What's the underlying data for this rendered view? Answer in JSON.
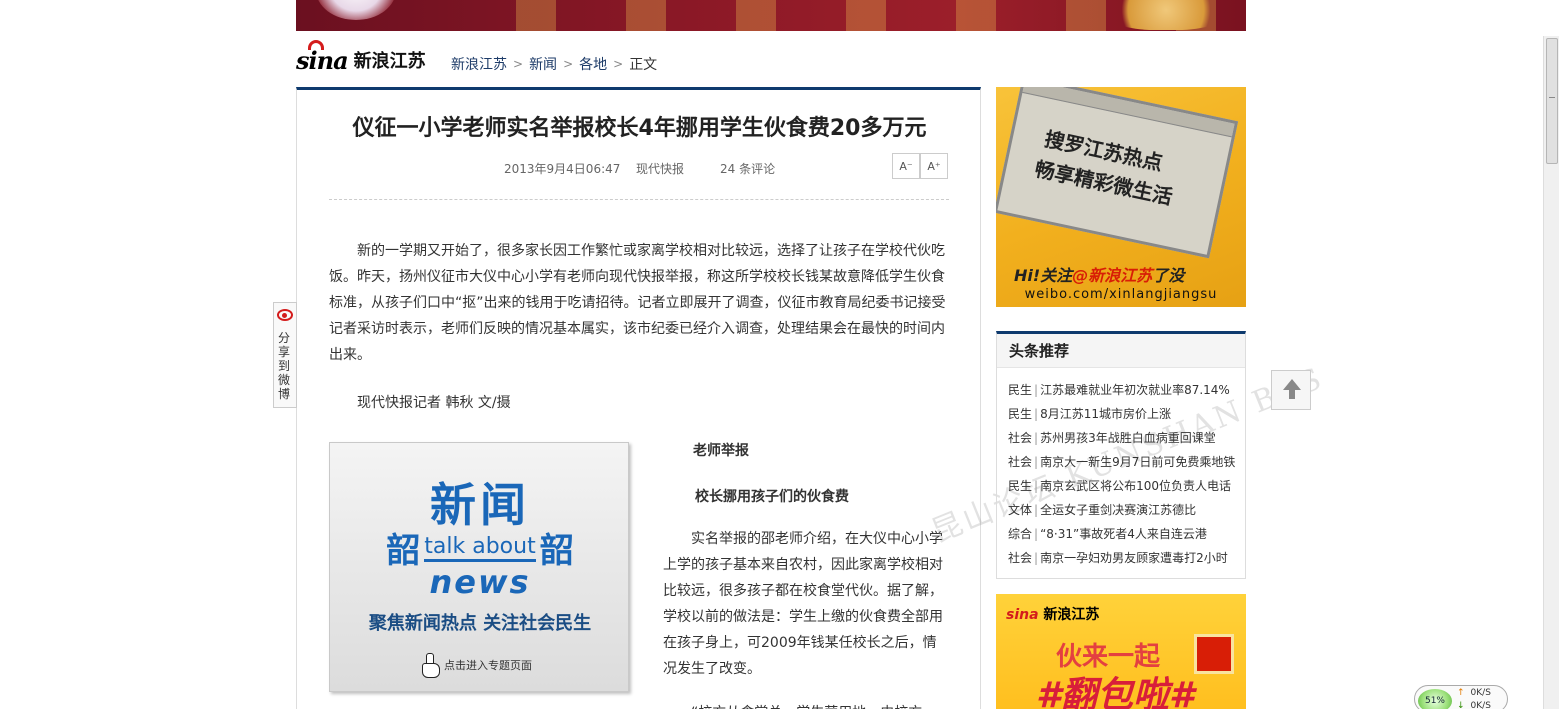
{
  "header": {
    "logo_brand": "sina",
    "logo_text": "新浪江苏",
    "breadcrumb": [
      {
        "label": "新浪江苏"
      },
      {
        "label": "新闻"
      },
      {
        "label": "各地"
      },
      {
        "label": "正文"
      }
    ],
    "breadcrumb_sep": ">"
  },
  "article": {
    "title": "仪征一小学老师实名举报校长4年挪用学生伙食费20多万元",
    "date": "2013年9月4日06:47",
    "source": "现代快报",
    "comments": "24 条评论",
    "font_decrease": "A⁻",
    "font_increase": "A⁺",
    "para1": "新的一学期又开始了，很多家长因工作繁忙或家离学校相对比较远，选择了让孩子在学校代伙吃饭。昨天，扬州仪征市大仪中心小学有老师向现代快报举报，称这所学校校长钱某故意降低学生伙食标准，从孩子们口中“抠”出来的钱用于吃请招待。记者立即展开了调查，仪征市教育局纪委书记接受记者采访时表示，老师们反映的情况基本属实，该市纪委已经介入调查，处理结果会在最快的时间内出来。",
    "para2": "现代快报记者 韩秋 文/摄",
    "subheading1": "老师举报",
    "subheading2": "校长挪用孩子们的伙食费",
    "para3": "实名举报的邵老师介绍，在大仪中心小学上学的孩子基本来自农村，因此家离学校相对比较远，很多孩子都在校食堂代伙。据了解，学校以前的做法是：学生上缴的伙食费全部用在孩子身上，可2009年钱某任校长之后，情况发生了改变。",
    "para4": "“校方从食堂总…学生营用地…由校方"
  },
  "news_promo": {
    "big": "新闻",
    "side_left": "韶",
    "talk": "talk about",
    "side_right": "韶",
    "news": "news",
    "slogan": "聚焦新闻热点  关注社会民生",
    "click": "点击进入专题页面"
  },
  "watermark": "昆山论坛 KUNSHAN BBS",
  "weibo_ad": {
    "line1": "搜罗江苏热点",
    "line2": "畅享精彩微生活",
    "hi_prefix": "Hi!关注",
    "hi_brand": "@新浪江苏",
    "hi_suffix": "了没",
    "url": "weibo.com/xinlangjiangsu"
  },
  "headlines": {
    "title": "头条推荐",
    "items": [
      {
        "cat": "民生",
        "text": "江苏最难就业年初次就业率87.14%"
      },
      {
        "cat": "民生",
        "text": "8月江苏11城市房价上涨"
      },
      {
        "cat": "社会",
        "text": "苏州男孩3年战胜白血病重回课堂"
      },
      {
        "cat": "社会",
        "text": "南京大一新生9月7日前可免费乘地铁"
      },
      {
        "cat": "民生",
        "text": "南京玄武区将公布100位负责人电话"
      },
      {
        "cat": "文体",
        "text": "全运女子重剑决赛演江苏德比"
      },
      {
        "cat": "综合",
        "text": "“8·31”事故死者4人来自连云港"
      },
      {
        "cat": "社会",
        "text": "南京一孕妇劝男友顾家遭毒打2小时"
      }
    ]
  },
  "red_ad": {
    "logo": "新浪江苏",
    "text1": "伙来一起",
    "text2": "#翻包啦#"
  },
  "share": {
    "text": "分享到微博"
  },
  "net_widget": {
    "percent": "51%",
    "up": "0K/S",
    "down": "0K/S"
  },
  "colors": {
    "accent": "#0e3a6e",
    "link": "#1d3b68",
    "brand_red": "#d41c1c"
  },
  "icons": [
    "sina-eye-icon",
    "hand-cursor-icon",
    "back-to-top-icon",
    "share-weibo-icon",
    "chevron-right-icon"
  ]
}
